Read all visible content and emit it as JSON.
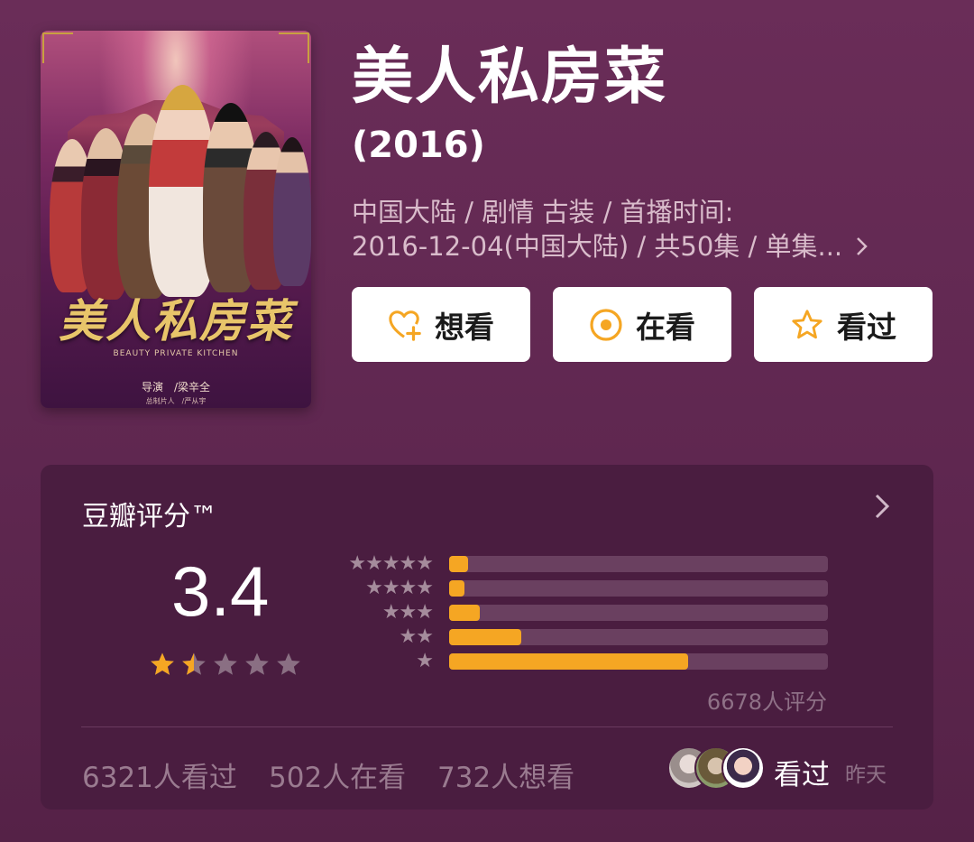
{
  "poster": {
    "calligraphy_title": "美人私房菜",
    "subtitle": "BEAUTY PRIVATE KITCHEN",
    "director_credit": "导演　/梁辛全",
    "producer_credit": "总制片人　/严从宇"
  },
  "header": {
    "title": "美人私房菜",
    "year": "(2016)",
    "meta_line1": "中国大陆 / 剧情 古装 / 首播时间:",
    "meta_line2": "2016-12-04(中国大陆) / 共50集 / 单集...",
    "more_icon": "chevron-right-icon"
  },
  "actions": {
    "want_label": "想看",
    "want_icon": "heart-plus-icon",
    "watching_label": "在看",
    "watching_icon": "target-circle-icon",
    "watched_label": "看过",
    "watched_icon": "star-outline-icon",
    "accent_color": "#f5a623"
  },
  "rating": {
    "section_title": "豆瓣评分™",
    "score": "3.4",
    "stars_value": 1.5,
    "stars_max": 5,
    "distribution": [
      {
        "stars": 5,
        "label": "★★★★★",
        "fraction": 0.05
      },
      {
        "stars": 4,
        "label": "★★★★",
        "fraction": 0.04
      },
      {
        "stars": 3,
        "label": "★★★",
        "fraction": 0.08
      },
      {
        "stars": 2,
        "label": "★★",
        "fraction": 0.19
      },
      {
        "stars": 1,
        "label": "★",
        "fraction": 0.63
      }
    ],
    "count_text": "6678人评分",
    "bar_color": "#f5a623"
  },
  "stats": {
    "watched": "6321人看过",
    "watching": "502人在看",
    "wanted": "732人想看",
    "friend_action": "看过",
    "friend_time": "昨天"
  }
}
